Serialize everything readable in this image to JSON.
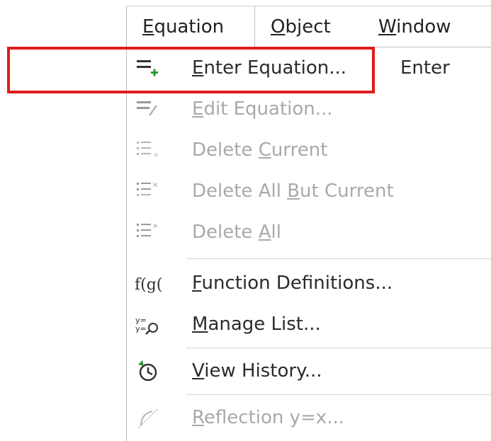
{
  "menubar": {
    "items": [
      {
        "label_pre": "",
        "mnemonic": "E",
        "label_post": "quation"
      },
      {
        "label_pre": "",
        "mnemonic": "O",
        "label_post": "bject"
      },
      {
        "label_pre": "",
        "mnemonic": "W",
        "label_post": "indow"
      }
    ]
  },
  "menu": {
    "items": [
      {
        "pre": "",
        "mn": "E",
        "post": "nter Equation...",
        "shortcut": "Enter",
        "icon": "enter-equation-icon",
        "enabled": true
      },
      {
        "pre": "",
        "mn": "E",
        "post": "dit Equation...",
        "icon": "edit-equation-icon",
        "enabled": false
      },
      {
        "pre": "Delete ",
        "mn": "C",
        "post": "urrent",
        "icon": "delete-current-icon",
        "enabled": false
      },
      {
        "pre": "Delete All ",
        "mn": "B",
        "post": "ut Current",
        "icon": "delete-all-but-current-icon",
        "enabled": false
      },
      {
        "pre": "Delete ",
        "mn": "A",
        "post": "ll",
        "icon": "delete-all-icon",
        "enabled": false
      },
      {
        "pre": "",
        "mn": "F",
        "post": "unction Definitions...",
        "icon": "function-definitions-icon",
        "enabled": true
      },
      {
        "pre": "",
        "mn": "M",
        "post": "anage List...",
        "icon": "manage-list-icon",
        "enabled": true
      },
      {
        "pre": "",
        "mn": "V",
        "post": "iew History...",
        "icon": "history-icon",
        "enabled": true
      },
      {
        "pre": "",
        "mn": "R",
        "post": "eflection y=x...",
        "icon": "reflection-icon",
        "enabled": false
      }
    ]
  },
  "colors": {
    "highlight": "#e01b1b",
    "enabled_text": "#2b2b2b",
    "disabled_text": "#a9a9a9",
    "green": "#2e9a2e"
  }
}
